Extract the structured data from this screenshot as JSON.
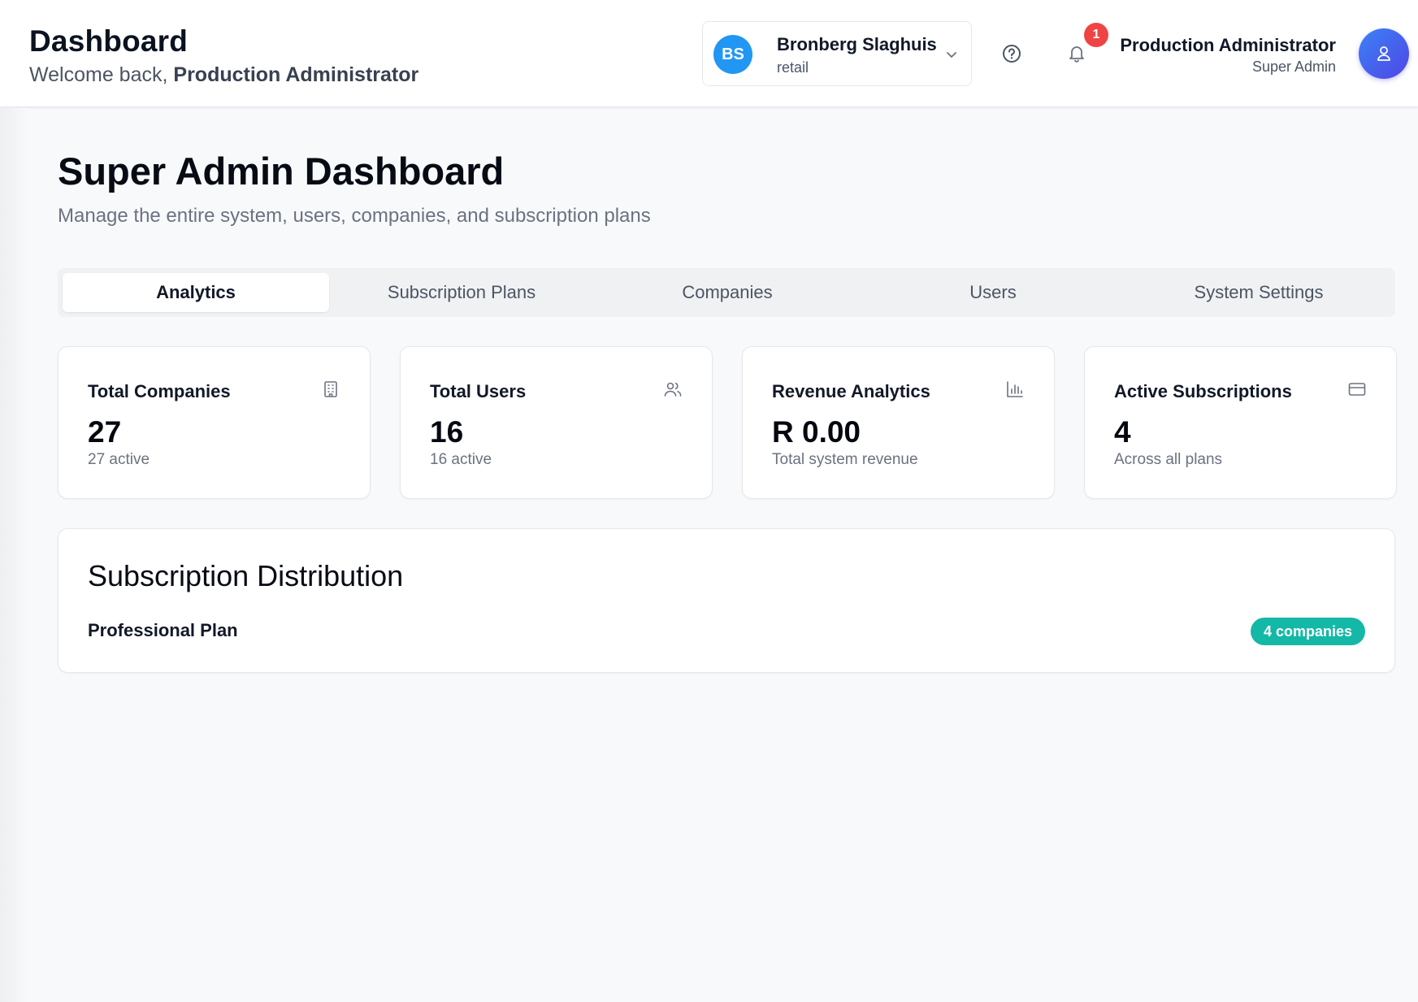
{
  "header": {
    "title": "Dashboard",
    "welcome_prefix": "Welcome back, ",
    "welcome_name": "Production Administrator"
  },
  "company": {
    "initials": "BS",
    "name": "Bronberg Slaghuis",
    "type": "retail"
  },
  "notifications": {
    "count": "1"
  },
  "user": {
    "name": "Production Administrator",
    "role": "Super Admin"
  },
  "main": {
    "title": "Super Admin Dashboard",
    "subtitle": "Manage the entire system, users, companies, and subscription plans"
  },
  "tabs": [
    {
      "label": "Analytics",
      "active": true
    },
    {
      "label": "Subscription Plans",
      "active": false
    },
    {
      "label": "Companies",
      "active": false
    },
    {
      "label": "Users",
      "active": false
    },
    {
      "label": "System Settings",
      "active": false
    }
  ],
  "stats": [
    {
      "label": "Total Companies",
      "value": "27",
      "note": "27 active",
      "icon": "building-icon"
    },
    {
      "label": "Total Users",
      "value": "16",
      "note": "16 active",
      "icon": "users-icon"
    },
    {
      "label": "Revenue Analytics",
      "value": "R 0.00",
      "note": "Total system revenue",
      "icon": "bar-chart-icon"
    },
    {
      "label": "Active Subscriptions",
      "value": "4",
      "note": "Across all plans",
      "icon": "credit-card-icon"
    }
  ],
  "distribution": {
    "title": "Subscription Distribution",
    "plans": [
      {
        "name": "Professional Plan",
        "badge": "4 companies"
      }
    ]
  },
  "colors": {
    "company_avatar": "#2196f3",
    "notification_badge": "#ef4444",
    "user_avatar_from": "#3b82f6",
    "user_avatar_to": "#4f46e5",
    "plan_badge": "#14b8a6"
  }
}
